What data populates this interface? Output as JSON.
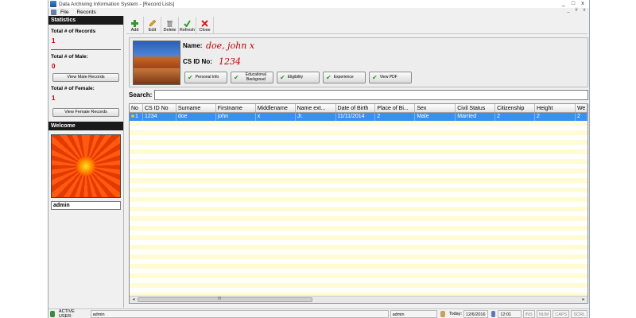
{
  "window": {
    "title": "Data Archiving Information System - [Record Lists]",
    "controls": [
      "_",
      "□",
      "x"
    ],
    "mdi_controls": [
      "_",
      "#",
      "x"
    ]
  },
  "menu": [
    "File",
    "Records"
  ],
  "statistics": {
    "heading": "Statistics",
    "total_records_label": "Total # of Records",
    "total_records_value": "1",
    "total_male_label": "Total # of Male:",
    "total_male_value": "0",
    "view_male_button": "View Male Records",
    "total_female_label": "Total # of Female:",
    "total_female_value": "1",
    "view_female_button": "View Female Records"
  },
  "welcome": {
    "heading": "Welcome",
    "username": "admin"
  },
  "toolbar": {
    "add": "Add",
    "edit": "Edit",
    "delete": "Delete",
    "refresh": "Refresh",
    "close": "Close"
  },
  "profile": {
    "name_label": "Name:",
    "name_value": "doe, john x",
    "id_label": "CS ID No:",
    "id_value": "1234",
    "tabs": [
      "Personal Info",
      "Educational Backgroud",
      "Eligibility",
      "Experience",
      "View PDF"
    ]
  },
  "search": {
    "label": "Search:",
    "value": ""
  },
  "grid": {
    "columns": [
      "No",
      "CS ID No",
      "Surname",
      "Firstname",
      "Middlename",
      "Name ext...",
      "Date of Birth",
      "Place of Bi...",
      "Sex",
      "Civil Status",
      "Citizenship",
      "Height",
      "We"
    ],
    "rows": [
      [
        "1",
        "1234",
        "doe",
        "john",
        "x",
        "Jr.",
        "11/11/2014",
        "2",
        "Male",
        "Married",
        "2",
        "2",
        "2"
      ]
    ],
    "scroll_left": "◂",
    "scroll_right": "▸",
    "scroll_grip": "III"
  },
  "statusbar": {
    "active_user_label": "ACTIVE USER:",
    "active_user_value": "admin",
    "user_cell": "admin",
    "today_label": "Today:",
    "today_value": "12/6/2016",
    "time_value": "12:01 PM",
    "keys": [
      "INS",
      "NUM",
      "CAPS",
      "SCRL"
    ]
  }
}
